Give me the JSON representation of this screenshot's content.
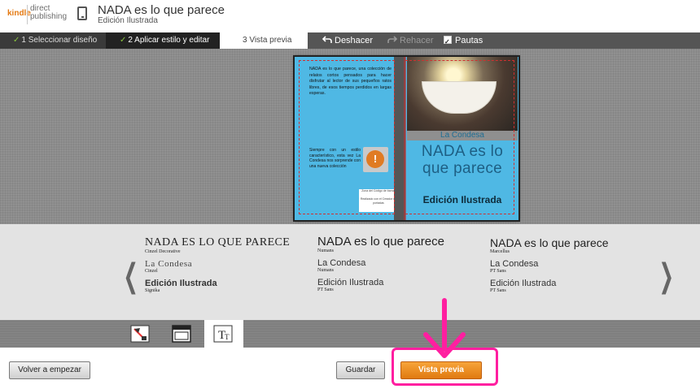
{
  "header": {
    "logo_kindle": "kindle",
    "logo_direct": "direct",
    "logo_publishing": "publishing",
    "book_title": "NADA es lo que parece",
    "book_subtitle": "Edición Ilustrada"
  },
  "steps": [
    {
      "label": "1 Seleccionar diseño",
      "status": "done"
    },
    {
      "label": "2 Aplicar estilo y editar",
      "status": "current"
    },
    {
      "label": "3 Vista previa",
      "status": "pending"
    }
  ],
  "tools": {
    "undo": "Deshacer",
    "redo": "Rehacer",
    "guides": "Pautas",
    "guides_checked": true
  },
  "cover": {
    "back_text": "NADA es lo que parece, una colección de relatos cortos pensados para hacer disfrutar al lector de sus pequeños ratos libres, de esos tiempos perdidos en largas esperas.",
    "back_text2": "Siempre con un estilo característico, esta vez La Condesa nos sorprende con una nueva colección",
    "barcode_line1": "Zona del Código de barras",
    "barcode_line2": "Realizado con el Creador de portadas",
    "author": "La Condesa",
    "title": "NADA es lo que parece",
    "edition": "Edición Ilustrada"
  },
  "font_options": [
    {
      "title": "NADA ES LO QUE PARECE",
      "title_font": "Cinzel Decorative",
      "author": "La Condesa",
      "author_font": "Cinzel",
      "edition": "Edición Ilustrada",
      "edition_font": "Signika"
    },
    {
      "title": "NADA es lo que parece",
      "title_font": "Numans",
      "author": "La Condesa",
      "author_font": "Numans",
      "edition": "Edición Ilustrada",
      "edition_font": "PT Sans"
    },
    {
      "title": "NADA es lo que parece",
      "title_font": "Marcellus",
      "author": "La Condesa",
      "author_font": "PT Sans",
      "edition": "Edición Ilustrada",
      "edition_font": "PT Sans"
    }
  ],
  "nav": {
    "prev": "❮",
    "next": "❯"
  },
  "footer": {
    "restart": "Volver a empezar",
    "save": "Guardar",
    "preview": "Vista previa"
  },
  "colors": {
    "accent": "#e47911",
    "cover_blue": "#4fb8e4",
    "highlight": "#ff1fa0"
  }
}
